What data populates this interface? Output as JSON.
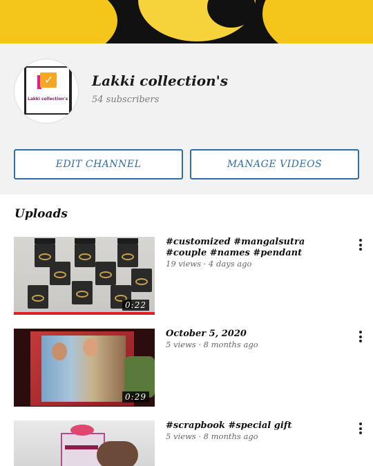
{
  "channel": {
    "name": "Lakki collection's",
    "subscribers": "54 subscribers",
    "logo_text": "Lakki collection's"
  },
  "actions": {
    "edit_label": "EDIT CHANNEL",
    "manage_label": "MANAGE VIDEOS"
  },
  "uploads": {
    "heading": "Uploads",
    "videos": [
      {
        "title": "#customized #mangalsutra #couple #names #pendant",
        "meta": "19 views · 4 days ago",
        "duration": "0:22",
        "watched_fraction": 1.0
      },
      {
        "title": "October 5, 2020",
        "meta": "5 views · 8 months ago",
        "duration": "0:29"
      },
      {
        "title": "#scrapbook #special gift",
        "meta": "5 views · 8 months ago",
        "duration": ""
      }
    ]
  },
  "colors": {
    "accent": "#2f6da6",
    "progress": "#e02020",
    "banner_yellow": "#f4c61c"
  },
  "icons": {
    "more": "more-vert-icon",
    "logo": "shopping-bag-check-icon"
  }
}
